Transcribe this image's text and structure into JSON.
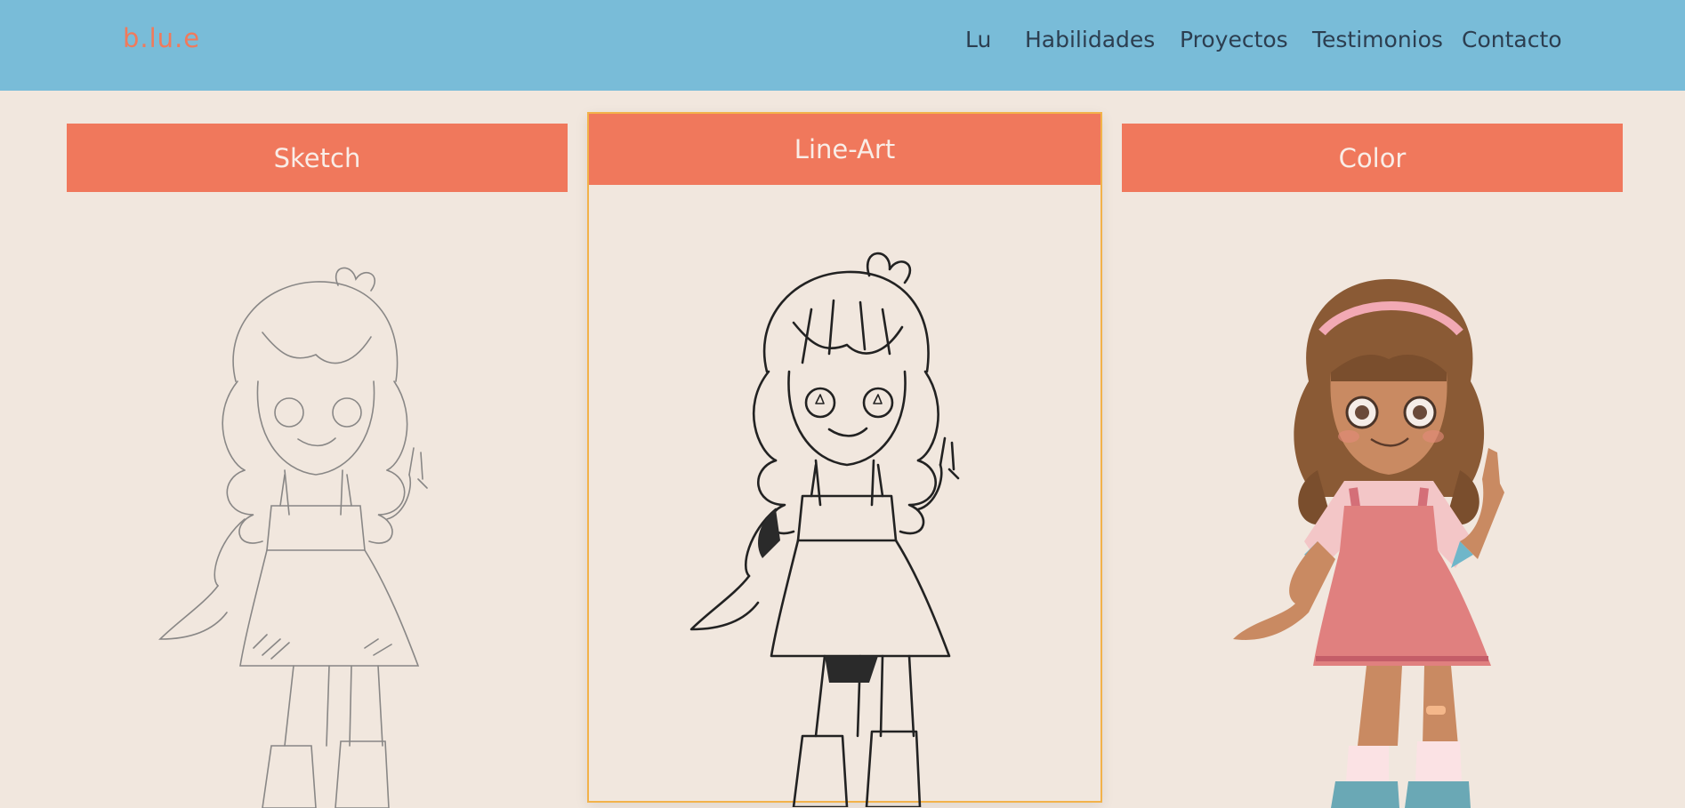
{
  "header": {
    "logo": "b.lu.e",
    "nav": [
      {
        "label": "Lu"
      },
      {
        "label": "Habilidades"
      },
      {
        "label": "Proyectos"
      },
      {
        "label": "Testimonios"
      },
      {
        "label": "Contacto"
      }
    ]
  },
  "cards": [
    {
      "title": "Sketch",
      "illustration": "pencil-sketch-character"
    },
    {
      "title": "Line-Art",
      "illustration": "line-art-character"
    },
    {
      "title": "Color",
      "illustration": "colored-character"
    }
  ],
  "colors": {
    "header_bg": "#79bcd8",
    "page_bg": "#f1e7de",
    "accent": "#f0785c",
    "active_border": "#f2b24a",
    "nav_text": "#2c3e50"
  }
}
